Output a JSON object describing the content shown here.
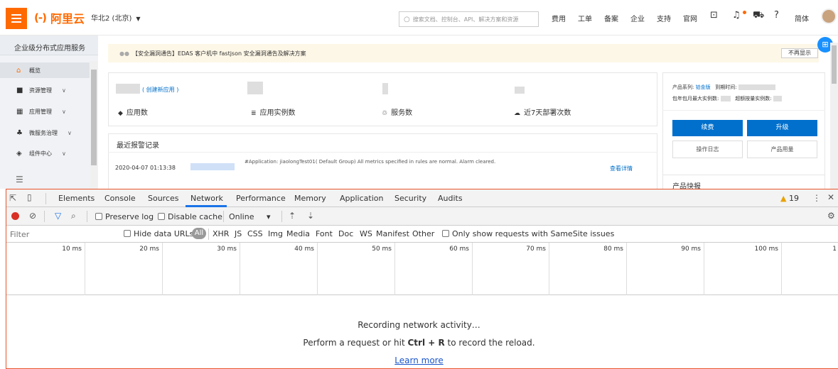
{
  "topbar": {
    "logo_text": "阿里云",
    "logo_mark": "(-)",
    "region": "华北2 (北京)",
    "search_placeholder": "搜索文档、控制台、API、解决方案和资源",
    "nav": [
      "费用",
      "工单",
      "备案",
      "企业",
      "支持",
      "官网"
    ],
    "lang": "简体"
  },
  "sidebar": {
    "title": "企业级分布式应用服务",
    "items": [
      {
        "label": "概览",
        "icon": "home-icon"
      },
      {
        "label": "资源管理",
        "icon": "folder-icon"
      },
      {
        "label": "应用管理",
        "icon": "apps-icon"
      },
      {
        "label": "微服务治理",
        "icon": "network-icon"
      },
      {
        "label": "组件中心",
        "icon": "layers-icon"
      }
    ]
  },
  "notice": {
    "text": "【安全漏洞通告】EDAS 客户机中 fastjson 安全漏洞通告及解决方案",
    "dismiss": "不再显示"
  },
  "stats": {
    "create_link": "( 创建新应用 )",
    "labels": [
      "应用数",
      "应用实例数",
      "服务数",
      "近7天部署次数"
    ]
  },
  "alarms": {
    "title": "最近报警记录",
    "time": "2020-04-07 01:13:38",
    "message": "#Application: jiaolongTest01( Default Group) All metrics specified in rules are normal. Alarm cleared.",
    "link": "查看详情"
  },
  "info": {
    "series_label": "产品系列:",
    "series_value": "铂金版",
    "expire_label": "到期时间:",
    "quota_label": "包年包月最大实例数:",
    "overquota_label": "超额按量实例数:",
    "btn_renew": "续费",
    "btn_upgrade": "升级",
    "btn_log": "操作日志",
    "btn_usage": "产品用量",
    "quick_title": "产品快报"
  },
  "devtools": {
    "tabs": [
      "Elements",
      "Console",
      "Sources",
      "Network",
      "Performance",
      "Memory",
      "Application",
      "Security",
      "Audits"
    ],
    "active_tab": "Network",
    "warnings": "19",
    "preserve_log": "Preserve log",
    "disable_cache": "Disable cache",
    "throttle": "Online",
    "filter_placeholder": "Filter",
    "hide_data_urls": "Hide data URLs",
    "types": [
      "All",
      "XHR",
      "JS",
      "CSS",
      "Img",
      "Media",
      "Font",
      "Doc",
      "WS",
      "Manifest",
      "Other"
    ],
    "samesite": "Only show requests with SameSite issues",
    "timeline_labels": [
      "10 ms",
      "20 ms",
      "30 ms",
      "40 ms",
      "50 ms",
      "60 ms",
      "70 ms",
      "80 ms",
      "90 ms",
      "100 ms",
      "1"
    ],
    "recording": "Recording network activity…",
    "hint_prefix": "Perform a request or hit",
    "hint_key": "Ctrl + R",
    "hint_suffix": "to record the reload.",
    "learn_more": "Learn more"
  }
}
